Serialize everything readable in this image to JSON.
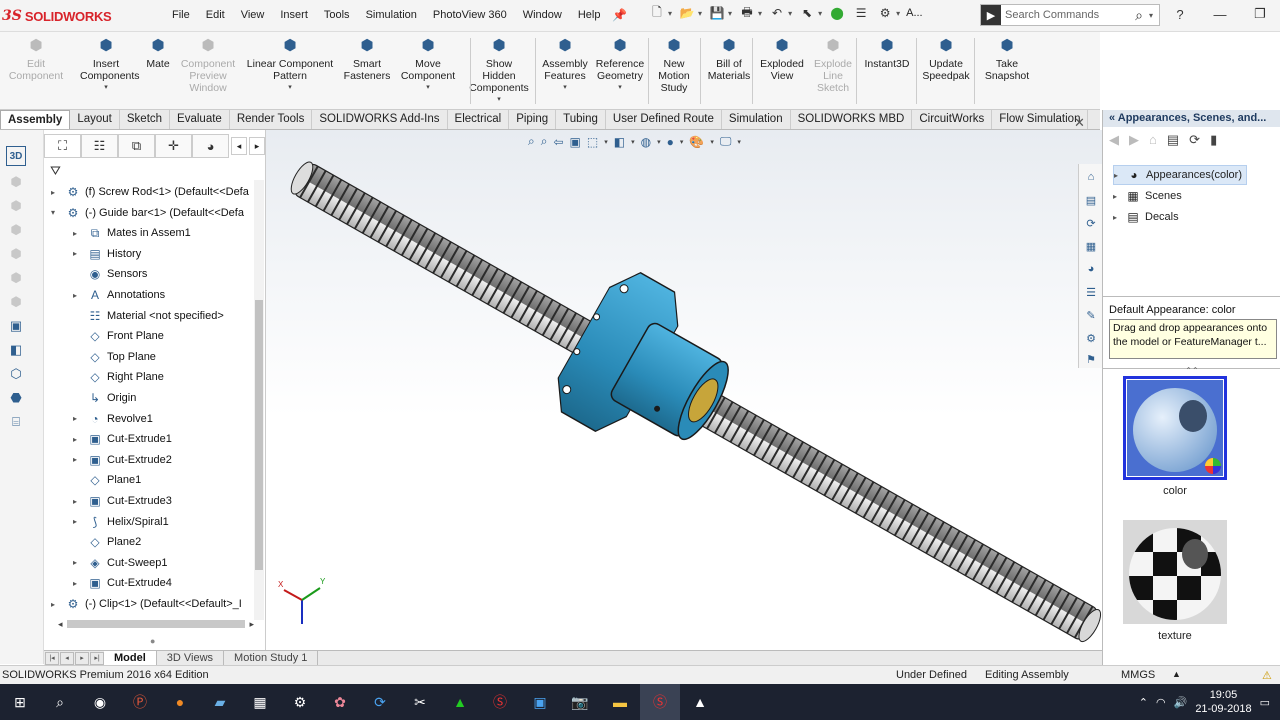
{
  "app": {
    "brand": "SOLIDWORKS",
    "brand_prefix": "3S"
  },
  "menu": [
    "File",
    "Edit",
    "View",
    "Insert",
    "Tools",
    "Simulation",
    "PhotoView 360",
    "Window",
    "Help"
  ],
  "search": {
    "placeholder": "Search Commands"
  },
  "quick_access_more": "A...",
  "commands": [
    {
      "label": "Edit\nComponent",
      "icon": "edit-component-icon",
      "disabled": true
    },
    {
      "label": "Insert\nComponents",
      "icon": "insert-components-icon",
      "disabled": false
    },
    {
      "label": "Mate",
      "icon": "mate-icon",
      "disabled": false
    },
    {
      "label": "Component\nPreview\nWindow",
      "icon": "preview-window-icon",
      "disabled": true
    },
    {
      "label": "Linear Component\nPattern",
      "icon": "linear-pattern-icon",
      "disabled": false
    },
    {
      "label": "Smart\nFasteners",
      "icon": "smart-fasteners-icon",
      "disabled": false
    },
    {
      "label": "Move\nComponent",
      "icon": "move-component-icon",
      "disabled": false
    },
    {
      "label": "Show\nHidden\nComponents",
      "icon": "show-hidden-icon",
      "disabled": false
    },
    {
      "label": "Assembly\nFeatures",
      "icon": "assembly-features-icon",
      "disabled": false
    },
    {
      "label": "Reference\nGeometry",
      "icon": "reference-geometry-icon",
      "disabled": false
    },
    {
      "label": "New\nMotion\nStudy",
      "icon": "motion-study-icon",
      "disabled": false
    },
    {
      "label": "Bill of\nMaterials",
      "icon": "bom-icon",
      "disabled": false
    },
    {
      "label": "Exploded\nView",
      "icon": "exploded-view-icon",
      "disabled": false
    },
    {
      "label": "Explode\nLine\nSketch",
      "icon": "explode-line-icon",
      "disabled": true
    },
    {
      "label": "Instant3D",
      "icon": "instant3d-icon",
      "disabled": false
    },
    {
      "label": "Update\nSpeedpak",
      "icon": "speedpak-icon",
      "disabled": false
    },
    {
      "label": "Take\nSnapshot",
      "icon": "snapshot-icon",
      "disabled": false
    }
  ],
  "tabs": [
    "Assembly",
    "Layout",
    "Sketch",
    "Evaluate",
    "Render Tools",
    "SOLIDWORKS Add-Ins",
    "Electrical",
    "Piping",
    "Tubing",
    "User Defined Route",
    "Simulation",
    "SOLIDWORKS MBD",
    "CircuitWorks",
    "Flow Simulation"
  ],
  "active_tab": "Assembly",
  "tree": [
    {
      "label": "(f) Screw Rod<1> (Default<<Defa",
      "icon": "part-icon",
      "expand": "▸",
      "indent": 0
    },
    {
      "label": "(-) Guide bar<1> (Default<<Defa",
      "icon": "part-icon",
      "expand": "▾",
      "indent": 0
    },
    {
      "label": "Mates in Assem1",
      "icon": "mates-icon",
      "expand": "▸",
      "indent": 1
    },
    {
      "label": "History",
      "icon": "history-icon",
      "expand": "▸",
      "indent": 1
    },
    {
      "label": "Sensors",
      "icon": "sensors-icon",
      "expand": "",
      "indent": 1
    },
    {
      "label": "Annotations",
      "icon": "annotations-icon",
      "expand": "▸",
      "indent": 1
    },
    {
      "label": "Material <not specified>",
      "icon": "material-icon",
      "expand": "",
      "indent": 1
    },
    {
      "label": "Front Plane",
      "icon": "plane-icon",
      "expand": "",
      "indent": 1
    },
    {
      "label": "Top Plane",
      "icon": "plane-icon",
      "expand": "",
      "indent": 1
    },
    {
      "label": "Right Plane",
      "icon": "plane-icon",
      "expand": "",
      "indent": 1
    },
    {
      "label": "Origin",
      "icon": "origin-icon",
      "expand": "",
      "indent": 1
    },
    {
      "label": "Revolve1",
      "icon": "revolve-icon",
      "expand": "▸",
      "indent": 1
    },
    {
      "label": "Cut-Extrude1",
      "icon": "cut-extrude-icon",
      "expand": "▸",
      "indent": 1
    },
    {
      "label": "Cut-Extrude2",
      "icon": "cut-extrude-icon",
      "expand": "▸",
      "indent": 1
    },
    {
      "label": "Plane1",
      "icon": "plane-icon",
      "expand": "",
      "indent": 1
    },
    {
      "label": "Cut-Extrude3",
      "icon": "cut-extrude-icon",
      "expand": "▸",
      "indent": 1
    },
    {
      "label": "Helix/Spiral1",
      "icon": "helix-icon",
      "expand": "▸",
      "indent": 1
    },
    {
      "label": "Plane2",
      "icon": "plane-icon",
      "expand": "",
      "indent": 1
    },
    {
      "label": "Cut-Sweep1",
      "icon": "cut-sweep-icon",
      "expand": "▸",
      "indent": 1
    },
    {
      "label": "Cut-Extrude4",
      "icon": "cut-extrude-icon",
      "expand": "▸",
      "indent": 1
    },
    {
      "label": "(-) Clip<1> (Default<<Default>_I",
      "icon": "part-icon",
      "expand": "▸",
      "indent": 0
    }
  ],
  "taskpane": {
    "title": "Appearances, Scenes, and...",
    "nodes": [
      {
        "label": "Appearances(color)",
        "icon": "appearances-icon",
        "selected": true
      },
      {
        "label": "Scenes",
        "icon": "scenes-icon",
        "selected": false
      },
      {
        "label": "Decals",
        "icon": "decals-icon",
        "selected": false
      }
    ],
    "default_appearance": "Default Appearance: color",
    "tooltip": "Drag and drop appearances onto the model or FeatureManager t...",
    "swatches": [
      {
        "label": "color",
        "selected": true
      },
      {
        "label": "texture",
        "selected": false
      }
    ]
  },
  "bottom_tabs": [
    "Model",
    "3D Views",
    "Motion Study 1"
  ],
  "active_bottom_tab": "Model",
  "status": {
    "edition": "SOLIDWORKS Premium 2016 x64 Edition",
    "state": "Under Defined",
    "mode": "Editing Assembly",
    "units": "MMGS"
  },
  "clock": {
    "time": "19:05",
    "date": "21-09-2018"
  },
  "triad": {
    "x": "X",
    "y": "Y"
  },
  "colors": {
    "nut": "#2a8bb8",
    "accent": "#d8232a",
    "taskbar": "#1c2230"
  }
}
